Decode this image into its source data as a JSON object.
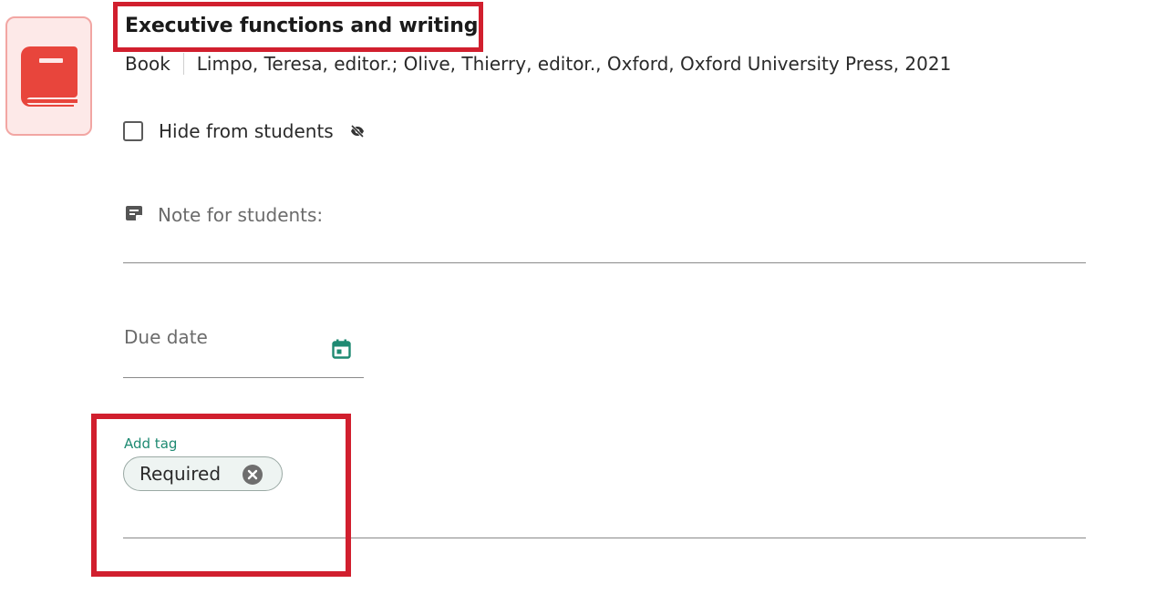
{
  "item": {
    "title": "Executive functions and writing",
    "type": "Book",
    "citation": "Limpo, Teresa, editor.; Olive, Thierry, editor., Oxford, Oxford University Press, 2021",
    "icon": "book-icon"
  },
  "visibility": {
    "hide_label": "Hide from students",
    "hidden": false,
    "icon": "eye-off-icon"
  },
  "note": {
    "label": "Note for students:",
    "value": "",
    "icon": "note-icon"
  },
  "due_date": {
    "label": "Due date",
    "value": "",
    "icon": "calendar-icon"
  },
  "tags": {
    "label": "Add tag",
    "chips": [
      {
        "label": "Required",
        "remove_icon": "close-circle-icon"
      }
    ]
  },
  "colors": {
    "highlight": "#d11f2e",
    "book_icon": "#e8453c",
    "accent": "#1e8a72"
  }
}
